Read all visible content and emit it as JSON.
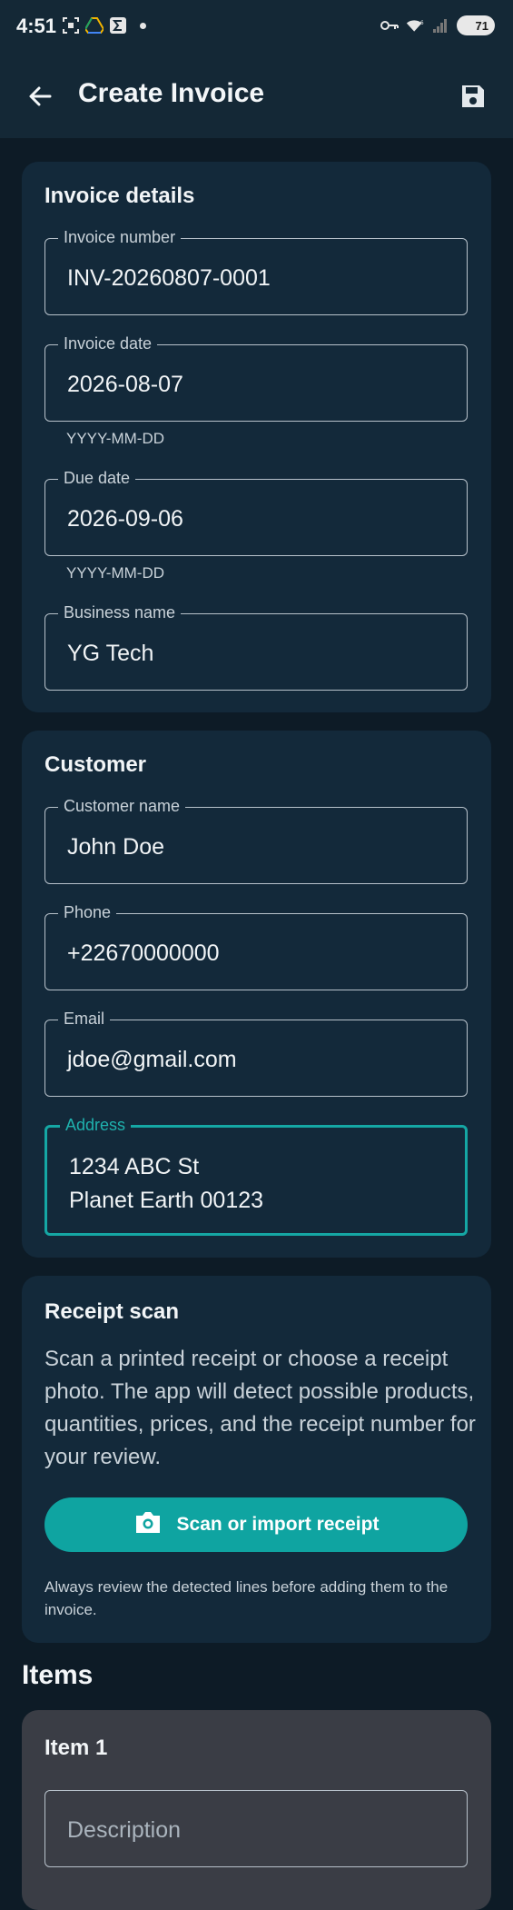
{
  "status_bar": {
    "time": "4:51",
    "battery": "71",
    "icons_left": [
      "screenshot-icon",
      "drive-icon",
      "sigma-app-icon"
    ],
    "icons_right": [
      "key-icon",
      "wifi-6-icon",
      "signal-icon",
      "battery-icon"
    ]
  },
  "app_bar": {
    "title": "Create Invoice",
    "back_icon": "arrow-back-icon",
    "save_icon": "save-icon"
  },
  "invoice_details": {
    "title": "Invoice details",
    "invoice_number": {
      "label": "Invoice number",
      "value": "INV-20260807-0001"
    },
    "invoice_date": {
      "label": "Invoice date",
      "value": "2026-08-07",
      "helper": "YYYY-MM-DD"
    },
    "due_date": {
      "label": "Due date",
      "value": "2026-09-06",
      "helper": "YYYY-MM-DD"
    },
    "business_name": {
      "label": "Business name",
      "value": "YG Tech"
    }
  },
  "customer": {
    "title": "Customer",
    "name": {
      "label": "Customer name",
      "value": "John Doe"
    },
    "phone": {
      "label": "Phone",
      "value": "+22670000000"
    },
    "email": {
      "label": "Email",
      "value": "jdoe@gmail.com"
    },
    "address": {
      "label": "Address",
      "value": "1234 ABC St\nPlanet Earth 00123"
    }
  },
  "receipt_scan": {
    "title": "Receipt scan",
    "description": "Scan a printed receipt or choose a receipt photo. The app will detect possible products, quantities, prices, and the receipt number for your review.",
    "button_label": "Scan or import receipt",
    "note": "Always review the detected lines before adding them to the invoice."
  },
  "items": {
    "heading": "Items",
    "item_1": {
      "title": "Item 1",
      "description_placeholder": "Description"
    }
  },
  "colors": {
    "accent": "#0fa4a1",
    "background": "#0d1b26",
    "card": "#13293a",
    "item_card": "#3a3d45"
  }
}
